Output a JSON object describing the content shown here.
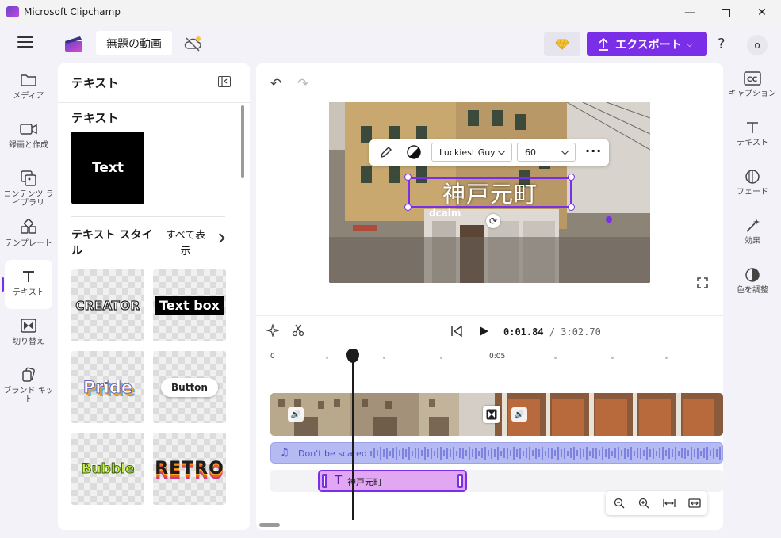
{
  "window": {
    "title": "Microsoft Clipchamp"
  },
  "header": {
    "project_title": "無題の動画",
    "export_label": "エクスポート",
    "help_label": "?",
    "avatar_initial": "o"
  },
  "left_nav": {
    "items": [
      {
        "label": "メディア",
        "icon": "folder-icon"
      },
      {
        "label": "録画と作成",
        "icon": "camera-icon"
      },
      {
        "label": "コンテンツ ライブラリ",
        "icon": "library-icon"
      },
      {
        "label": "テンプレート",
        "icon": "template-icon"
      },
      {
        "label": "テキスト",
        "icon": "text-icon",
        "active": true
      },
      {
        "label": "切り替え",
        "icon": "transition-icon"
      },
      {
        "label": "ブランド キット",
        "icon": "brand-kit-icon"
      }
    ]
  },
  "text_panel": {
    "title": "テキスト",
    "section_title": "テキスト",
    "text_card_label": "Text",
    "styles_title": "テキスト スタイル",
    "show_all_label": "すべて表示",
    "tiles": [
      {
        "label": "CREATOR"
      },
      {
        "label": "Text box"
      },
      {
        "label": "Pride"
      },
      {
        "label": "Button"
      },
      {
        "label": "Bubble"
      },
      {
        "label": "RETRO"
      }
    ]
  },
  "preview": {
    "overlay_text": "神戸元町",
    "sign_text": "dcalm",
    "font_name": "Luckiest Guy",
    "font_size": "60"
  },
  "timeline": {
    "current_time": "0:01.84",
    "total_time": "/ 3:02.70",
    "ruler_labels": [
      "0",
      "0:05"
    ],
    "audio_clip_name": "Don't be scared",
    "text_clip_name": "神戸元町"
  },
  "right_nav": {
    "items": [
      {
        "label": "キャプション",
        "icon": "captions-icon"
      },
      {
        "label": "テキスト",
        "icon": "text-icon"
      },
      {
        "label": "フェード",
        "icon": "fade-icon"
      },
      {
        "label": "効果",
        "icon": "effects-icon"
      },
      {
        "label": "色を調整",
        "icon": "color-adjust-icon"
      }
    ]
  },
  "colors": {
    "accent": "#7b2ee8",
    "audio_track": "#b6baf2",
    "text_clip": "#e1a7f3"
  }
}
